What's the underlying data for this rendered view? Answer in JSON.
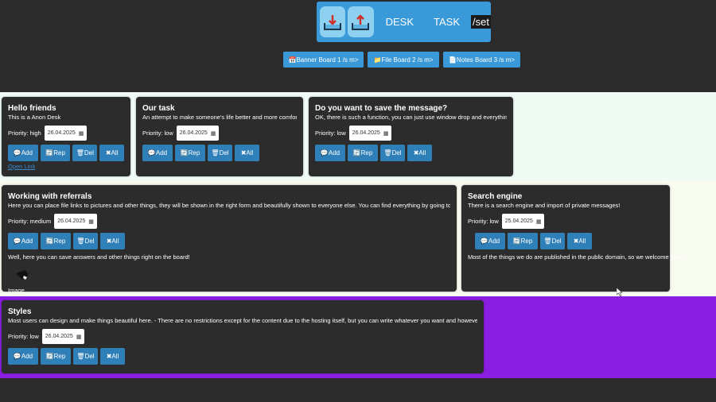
{
  "nav": {
    "desk_label": "DESK",
    "task_label": "TASK",
    "set_label": "/set",
    "icons": [
      "download-tray-icon",
      "upload-tray-icon"
    ]
  },
  "boards": [
    {
      "label": "📅Banner Board 1 /s m>"
    },
    {
      "label": "📁File Board 2 /s m>"
    },
    {
      "label": "📄Notes Board 3 /s m>"
    }
  ],
  "buttons": {
    "add": "💬Add",
    "rep": "🔄Rep",
    "del": "🗑Del",
    "all": "✖All"
  },
  "priority_prefix": "Priority:",
  "cards": [
    {
      "title": "Hello friends",
      "desc": "This is a Anon Desk",
      "priority": "high",
      "date": "26.04.2025",
      "link": "Open Link"
    },
    {
      "title": "Our task",
      "desc": "An attempt to make someone's life better and more comfortable",
      "priority": "low",
      "date": "26.04.2025"
    },
    {
      "title": "Do you want to save the message?",
      "desc": "OK, there is such a function, you can just use window drop and everything else.",
      "priority": "low",
      "date": "26.04.2025"
    },
    {
      "title": "Working with referrals",
      "desc": "Here you can place file links to pictures and other things, they will be shown in the right form and beautifully shown to everyone else. You can find everything by going to the page for ->",
      "priority": "medium",
      "date": "26.04.2025",
      "extra": "Well, here you can save answers and other things right on the board!",
      "image_label": "Image"
    },
    {
      "title": "Search engine",
      "desc": "There is a search engine and import of private messages!",
      "priority": "low",
      "date": "25.04.2025",
      "extra": "Most of the things we do are published in the public domain, so we welcome you!"
    },
    {
      "title": "Styles",
      "desc": "Most users can design and make things beautiful here. - There are no restrictions except for the content due to the hosting itself, but you can write whatever you want and however you want.",
      "priority": "low",
      "date": "26.04.2025"
    }
  ],
  "colors": {
    "nav_blue": "#3a9ad9",
    "button_blue": "#2f7fb8",
    "card_bg": "#2c2c2c",
    "purple_section": "#8a1ee0"
  }
}
